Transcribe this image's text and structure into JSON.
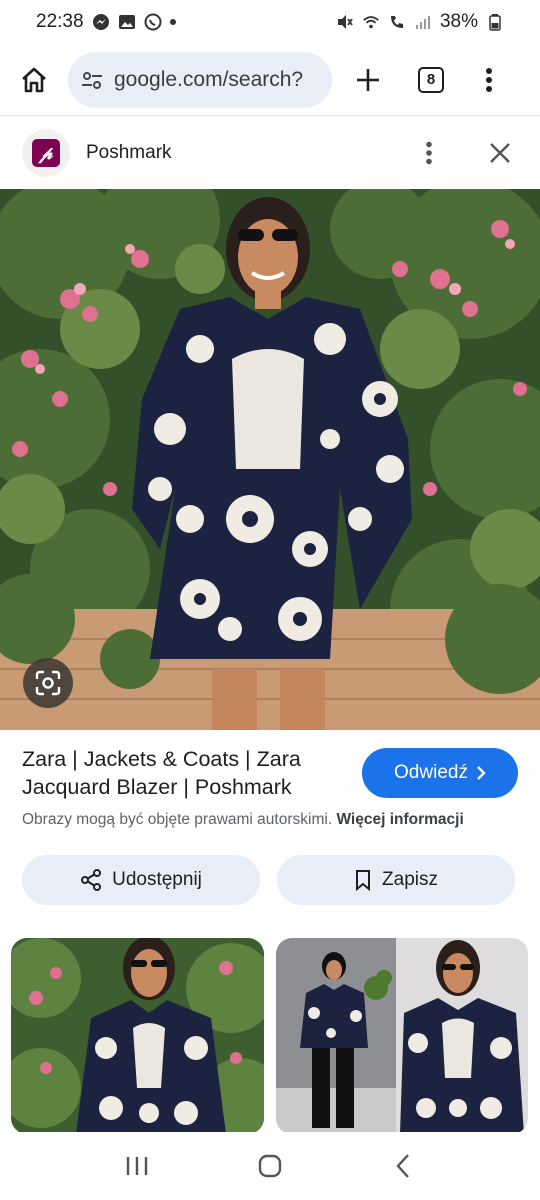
{
  "status": {
    "time": "22:38",
    "battery": "38%"
  },
  "browser": {
    "url": "google.com/search?",
    "tab_count": "8"
  },
  "source": {
    "name": "Poshmark",
    "logo_letter": "p"
  },
  "result": {
    "title": "Zara | Jackets & Coats | Zara Jacquard Blazer | Poshmark",
    "visit_label": "Odwiedź",
    "copyright_text": "Obrazy mogą być objęte prawami autorskimi.",
    "copyright_more": "Więcej informacji"
  },
  "actions": {
    "share_label": "Udostępnij",
    "save_label": "Zapisz"
  },
  "colors": {
    "accent": "#1a73e8",
    "poshmark": "#7f0353",
    "chip_bg": "#e8eef8"
  }
}
